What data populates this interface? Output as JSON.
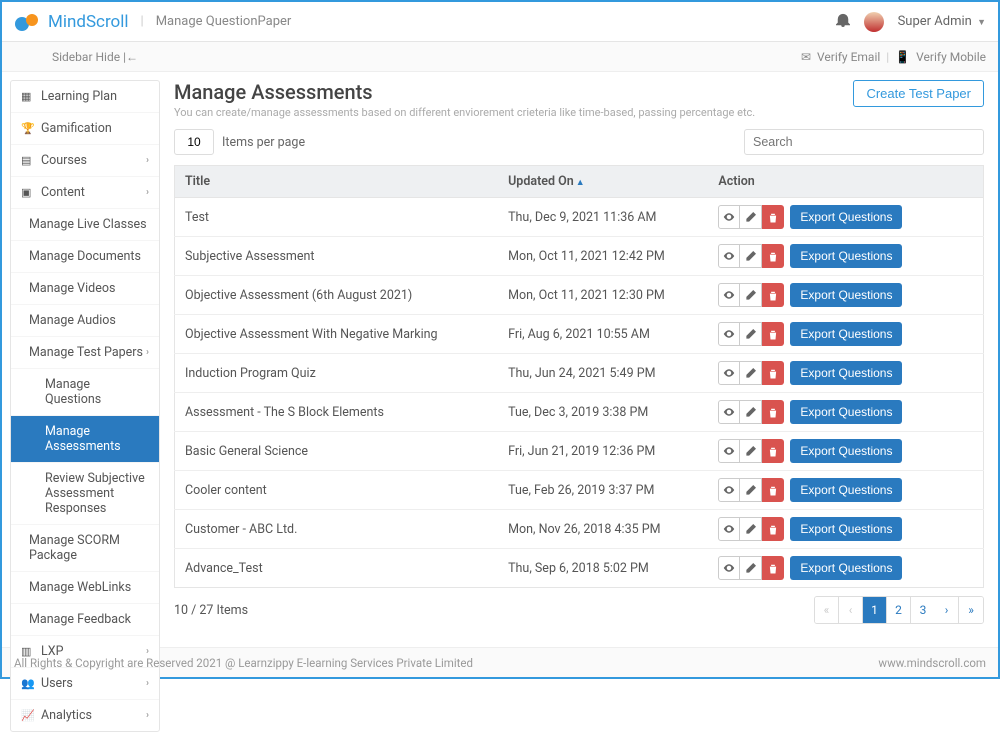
{
  "brand": {
    "name": "MindScroll"
  },
  "breadcrumb": "Manage QuestionPaper",
  "user": {
    "name": "Super Admin"
  },
  "subbar": {
    "hide": "Sidebar Hide |←",
    "verify_email": "Verify Email",
    "verify_mobile": "Verify Mobile"
  },
  "sidebar": {
    "learning_plan": "Learning Plan",
    "gamification": "Gamification",
    "courses": "Courses",
    "content": "Content",
    "manage_live_classes": "Manage Live Classes",
    "manage_documents": "Manage Documents",
    "manage_videos": "Manage Videos",
    "manage_audios": "Manage Audios",
    "manage_test_papers": "Manage Test Papers",
    "manage_questions": "Manage Questions",
    "manage_assessments": "Manage Assessments",
    "review_subjective": "Review Subjective Assessment Responses",
    "manage_scorm": "Manage SCORM Package",
    "manage_weblinks": "Manage WebLinks",
    "manage_feedback": "Manage Feedback",
    "lxp": "LXP",
    "users": "Users",
    "analytics": "Analytics"
  },
  "page": {
    "title": "Manage Assessments",
    "subtitle": "You can create/manage assessments based on different enviorement crieteria like time-based, passing percentage etc.",
    "create_btn": "Create Test Paper",
    "items_per_page_value": "10",
    "items_per_page_label": "Items per page",
    "search_placeholder": "Search",
    "col_title": "Title",
    "col_updated": "Updated On",
    "col_action": "Action",
    "export_label": "Export Questions",
    "items_count": "10 / 27 Items"
  },
  "rows": [
    {
      "title": "Test",
      "updated": "Thu, Dec 9, 2021 11:36 AM"
    },
    {
      "title": "Subjective Assessment",
      "updated": "Mon, Oct 11, 2021 12:42 PM"
    },
    {
      "title": "Objective Assessment (6th August 2021)",
      "updated": "Mon, Oct 11, 2021 12:30 PM"
    },
    {
      "title": "Objective Assessment With Negative Marking",
      "updated": "Fri, Aug 6, 2021 10:55 AM"
    },
    {
      "title": "Induction Program Quiz",
      "updated": "Thu, Jun 24, 2021 5:49 PM"
    },
    {
      "title": "Assessment - The S Block Elements",
      "updated": "Tue, Dec 3, 2019 3:38 PM"
    },
    {
      "title": "Basic General Science",
      "updated": "Fri, Jun 21, 2019 12:36 PM"
    },
    {
      "title": "Cooler content",
      "updated": "Tue, Feb 26, 2019 3:37 PM"
    },
    {
      "title": "Customer - ABC Ltd.",
      "updated": "Mon, Nov 26, 2018 4:35 PM"
    },
    {
      "title": "Advance_Test",
      "updated": "Thu, Sep 6, 2018 5:02 PM"
    }
  ],
  "pagination": {
    "pages": [
      "1",
      "2",
      "3"
    ],
    "active": "1"
  },
  "footer": {
    "left": "All Rights & Copyright are Reserved 2021 @ Learnzippy E-learning Services Private Limited",
    "right": "www.mindscroll.com"
  }
}
